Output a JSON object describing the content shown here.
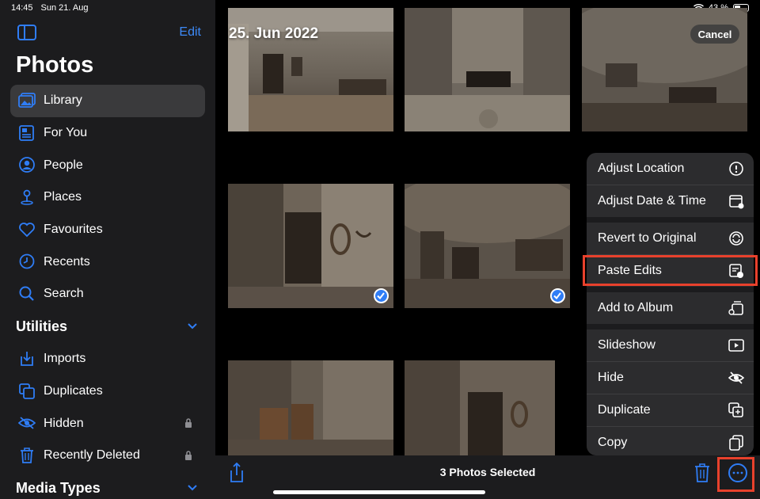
{
  "status_bar": {
    "time": "14:45",
    "date": "Sun 21. Aug",
    "battery": "43 %"
  },
  "sidebar": {
    "edit_label": "Edit",
    "title": "Photos",
    "items": [
      {
        "label": "Library",
        "icon": "library-icon",
        "selected": true
      },
      {
        "label": "For You",
        "icon": "for-you-icon"
      },
      {
        "label": "People",
        "icon": "people-icon"
      },
      {
        "label": "Places",
        "icon": "places-icon"
      },
      {
        "label": "Favourites",
        "icon": "heart-icon"
      },
      {
        "label": "Recents",
        "icon": "clock-icon"
      },
      {
        "label": "Search",
        "icon": "search-icon"
      }
    ],
    "utilities_label": "Utilities",
    "utilities": [
      {
        "label": "Imports",
        "icon": "imports-icon"
      },
      {
        "label": "Duplicates",
        "icon": "duplicates-icon"
      },
      {
        "label": "Hidden",
        "icon": "eye-slash-icon",
        "locked": true
      },
      {
        "label": "Recently Deleted",
        "icon": "trash-icon",
        "locked": true
      }
    ],
    "media_types_label": "Media Types"
  },
  "grid": {
    "date_label": "25. Jun 2022",
    "cancel_label": "Cancel"
  },
  "menu": {
    "items": [
      {
        "label": "Adjust Location",
        "icon": "info-icon"
      },
      {
        "label": "Adjust Date & Time",
        "icon": "calendar-icon"
      },
      {
        "label": "Revert to Original",
        "icon": "revert-icon"
      },
      {
        "label": "Paste Edits",
        "icon": "paste-edits-icon",
        "highlighted": true
      },
      {
        "label": "Add to Album",
        "icon": "add-album-icon"
      },
      {
        "label": "Slideshow",
        "icon": "play-icon"
      },
      {
        "label": "Hide",
        "icon": "eye-slash-icon"
      },
      {
        "label": "Duplicate",
        "icon": "duplicate-icon"
      },
      {
        "label": "Copy",
        "icon": "copy-icon"
      }
    ]
  },
  "toolbar": {
    "selection_text": "3 Photos Selected"
  },
  "colors": {
    "accent": "#2f7df6",
    "highlight": "#e8412c",
    "sidebar_bg": "#1c1c1e",
    "menu_bg": "#2c2c2e"
  }
}
